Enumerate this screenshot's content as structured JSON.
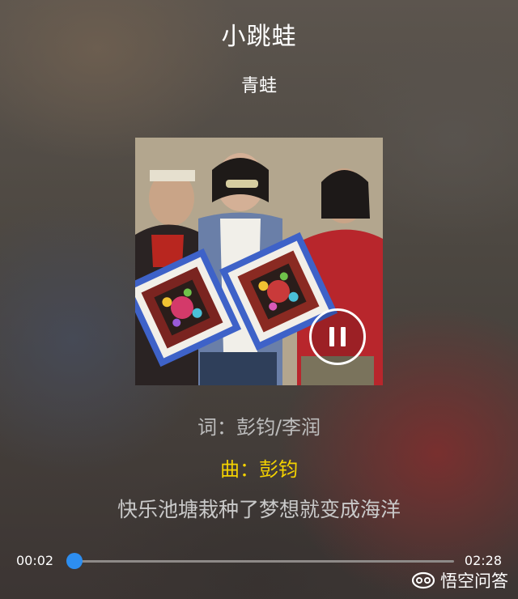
{
  "song": {
    "title": "小跳蛙",
    "artist": "青蛙"
  },
  "lyrics": {
    "line1": "词：彭钧/李润",
    "line2": "曲：彭钧",
    "line3": "快乐池塘栽种了梦想就变成海洋"
  },
  "player": {
    "current_time": "00:02",
    "total_time": "02:28",
    "progress_fraction": 0.014,
    "state_icon": "pause-icon"
  },
  "watermark": {
    "text": "悟空问答",
    "icon": "wukong-logo-icon"
  },
  "colors": {
    "highlight_lyric": "#f4d200",
    "progress_thumb": "#2d8ef0"
  }
}
